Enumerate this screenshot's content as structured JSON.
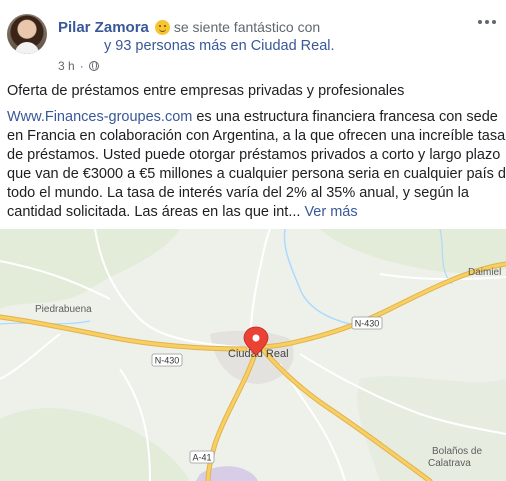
{
  "post": {
    "author": "Pilar Zamora",
    "feeling": "se siente fantástico con",
    "tagged_others": "y 93 personas más en Ciudad Real.",
    "timestamp": "3 h",
    "separator": "·",
    "title": "Oferta de préstamos entre empresas privadas y profesionales",
    "body": {
      "link_text": "Www.Finances-groupes.com",
      "lines": [
        " es una estructura financiera francesa con sede",
        "en Francia en colaboración con Argentina, a la que ofrecen una increíble tasa",
        "de préstamos. Usted puede otorgar préstamos privados a corto y largo plazo",
        "que van de €3000 a €5 millones a cualquier persona seria en cualquier país de",
        "todo el mundo. La tasa de interés varía del 2% al 35% anual, y según la",
        "cantidad solicitada. Las áreas en las que int..."
      ],
      "see_more": "Ver más"
    }
  },
  "map": {
    "places": {
      "daimiel": "Daimiel",
      "piedrabuena": "Piedrabuena",
      "ciudad_real": "Ciudad Real",
      "bolanos_1": "Bolaños de",
      "bolanos_2": "Calatrava"
    },
    "roads": {
      "n430_east": "N-430",
      "n430_west": "N-430",
      "a41": "A-41"
    },
    "colors": {
      "pin": "#ea4335",
      "highway": "#f6cf65",
      "highway_edge": "#e4b24a",
      "water": "#aadaff"
    }
  },
  "icons": {
    "feeling": "smiling-face-emoji",
    "privacy": "globe-icon",
    "options": "more-options-icon",
    "location": "map-pin-icon"
  }
}
